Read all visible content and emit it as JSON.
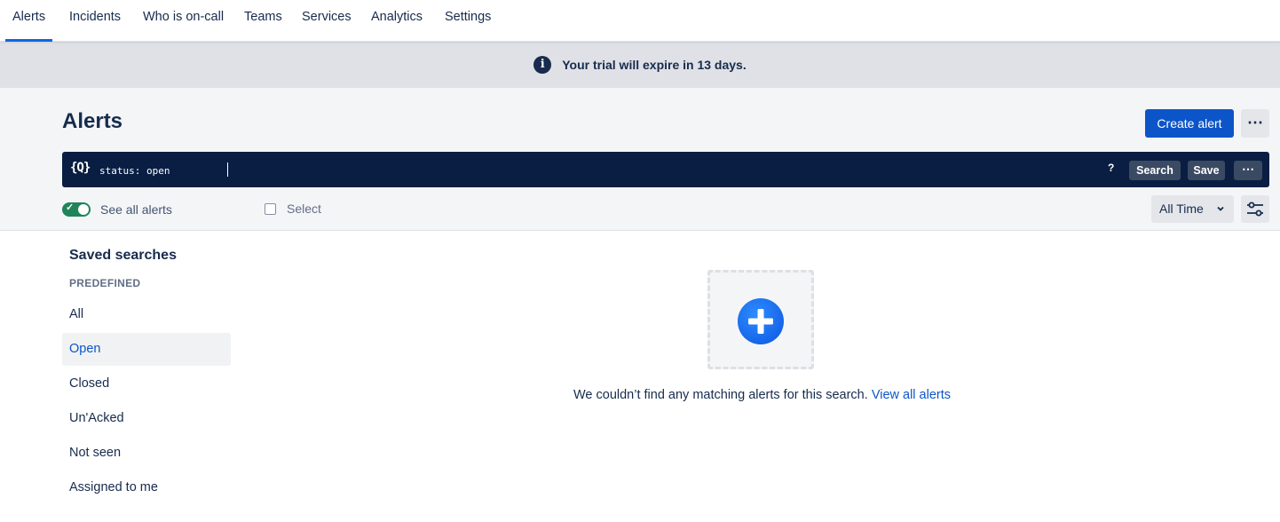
{
  "nav": {
    "tabs": [
      "Alerts",
      "Incidents",
      "Who is on-call",
      "Teams",
      "Services",
      "Analytics",
      "Settings"
    ],
    "active": "Alerts"
  },
  "banner": {
    "message": "Your trial will expire in 13 days.",
    "icon": "info-icon"
  },
  "header": {
    "title": "Alerts",
    "create_label": "Create alert",
    "more_label": "⋯"
  },
  "search": {
    "icon_label": "{Q}",
    "query": "status: open",
    "help_label": "?",
    "search_label": "Search",
    "save_label": "Save",
    "more_label": "⋯"
  },
  "filters": {
    "see_all_label": "See all alerts",
    "see_all_on": true,
    "select_label": "Select",
    "time_range": "All Time"
  },
  "sidebar": {
    "title": "Saved searches",
    "section": "PREDEFINED",
    "items": [
      {
        "label": "All"
      },
      {
        "label": "Open"
      },
      {
        "label": "Closed"
      },
      {
        "label": "Un'Acked"
      },
      {
        "label": "Not seen"
      },
      {
        "label": "Assigned to me"
      }
    ],
    "active": "Open"
  },
  "empty_state": {
    "message": "We couldn’t find any matching alerts for this search.",
    "link": "View all alerts"
  },
  "colors": {
    "primary": "#0c55c8",
    "searchbar_bg": "#091e42",
    "banner_bg": "#dfe1e6",
    "toggle_on": "#1f845a",
    "text": "#172b4d"
  }
}
